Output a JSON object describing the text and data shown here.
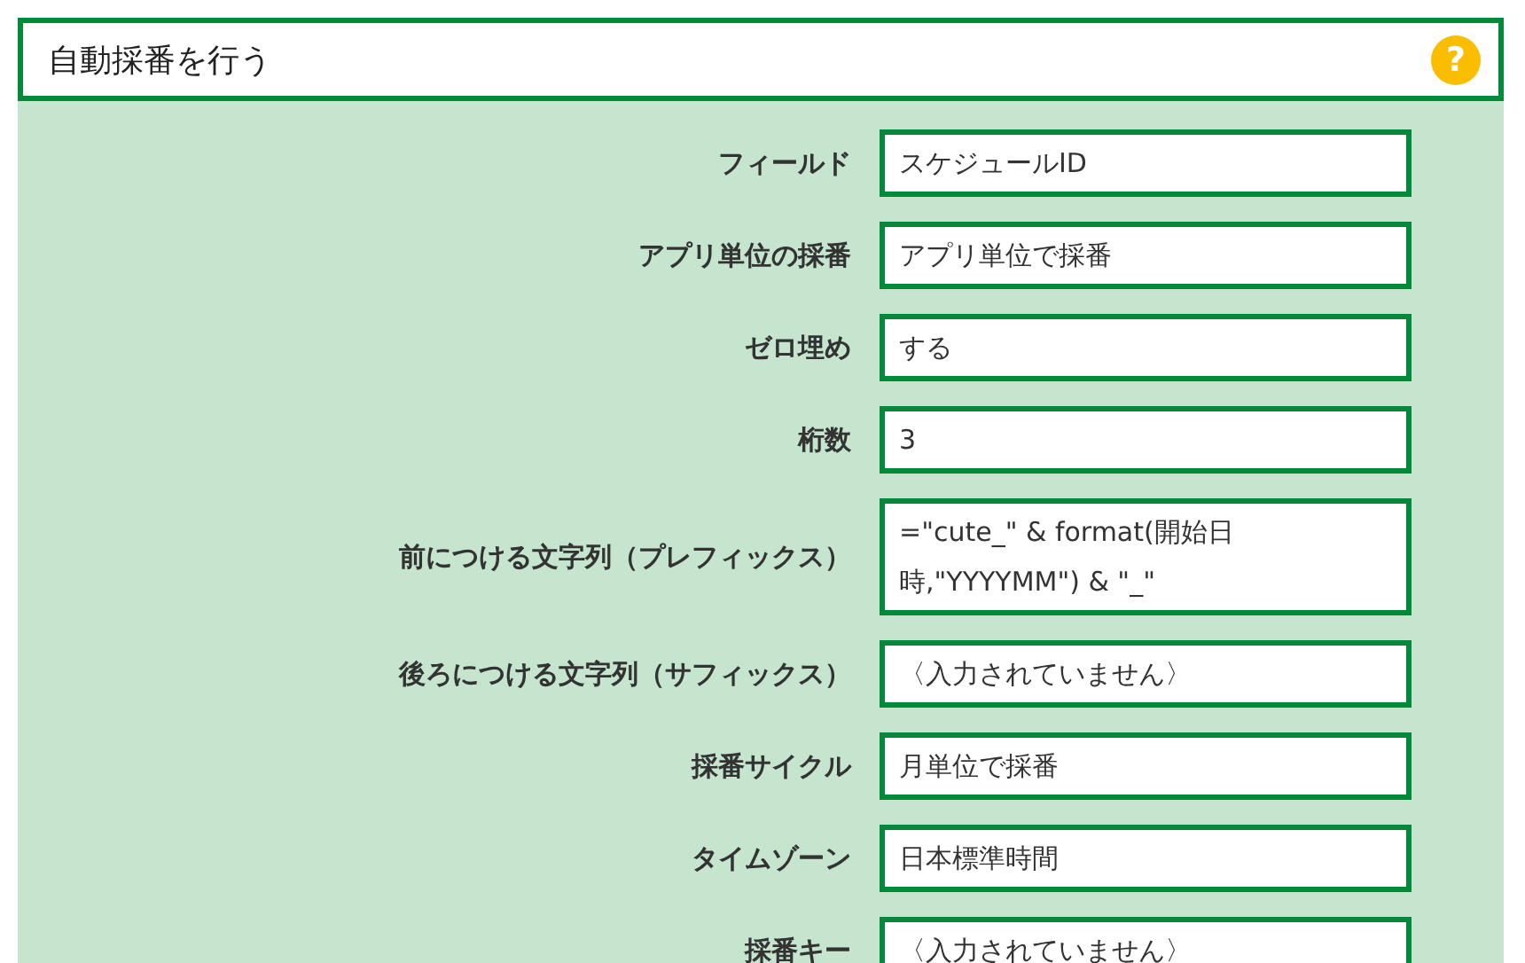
{
  "header": {
    "title": "自動採番を行う",
    "help": "?"
  },
  "fields": [
    {
      "label": "フィールド",
      "value": "スケジュールID"
    },
    {
      "label": "アプリ単位の採番",
      "value": "アプリ単位で採番"
    },
    {
      "label": "ゼロ埋め",
      "value": "する"
    },
    {
      "label": "桁数",
      "value": "3"
    },
    {
      "label": "前につける文字列（プレフィックス）",
      "value": "=\"cute_\" & format(開始日時,\"YYYYMM\") & \"_\""
    },
    {
      "label": "後ろにつける文字列（サフィックス）",
      "value": "〈入力されていません〉"
    },
    {
      "label": "採番サイクル",
      "value": "月単位で採番"
    },
    {
      "label": "タイムゾーン",
      "value": "日本標準時間"
    },
    {
      "label": "採番キー",
      "value": "〈入力されていません〉"
    }
  ]
}
